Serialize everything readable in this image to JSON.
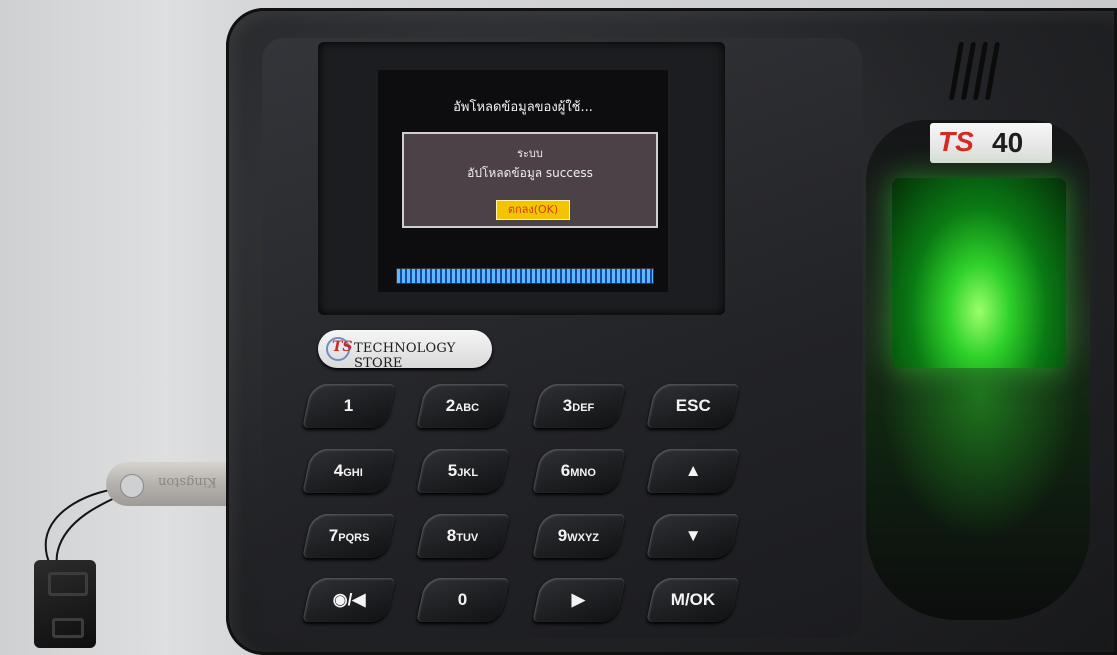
{
  "screen": {
    "title": "อัพโหลดข้อมูลของผู้ใช้...",
    "dialog_heading": "ระบบ",
    "dialog_message": "อัปโหลดข้อมูล success",
    "ok_label": "ตกลง(OK)",
    "progress_fraction": 1.0
  },
  "brand_plate": {
    "logo_text": "TS",
    "name": "TECHNOLOGY STORE"
  },
  "model_badge": {
    "prefix": "TS",
    "number": "40"
  },
  "usb_engraving": "Kingston",
  "keypad": [
    {
      "main": "1",
      "sub": ""
    },
    {
      "main": "2",
      "sub": "ABC"
    },
    {
      "main": "3",
      "sub": "DEF"
    },
    {
      "main": "ESC",
      "sub": ""
    },
    {
      "main": "4",
      "sub": "GHI"
    },
    {
      "main": "5",
      "sub": "JKL"
    },
    {
      "main": "6",
      "sub": "MNO"
    },
    {
      "main": "▲",
      "sub": ""
    },
    {
      "main": "7",
      "sub": "PQRS"
    },
    {
      "main": "8",
      "sub": "TUV"
    },
    {
      "main": "9",
      "sub": "WXYZ"
    },
    {
      "main": "▼",
      "sub": ""
    },
    {
      "main": "◉/◀",
      "sub": ""
    },
    {
      "main": "0",
      "sub": ""
    },
    {
      "main": "▶",
      "sub": ""
    },
    {
      "main": "M/OK",
      "sub": ""
    }
  ],
  "colors": {
    "device_body": "#232427",
    "scanner_glow": "#2fd12a",
    "ok_button": "#f4c400",
    "progress_bar": "#5fb7ff"
  }
}
